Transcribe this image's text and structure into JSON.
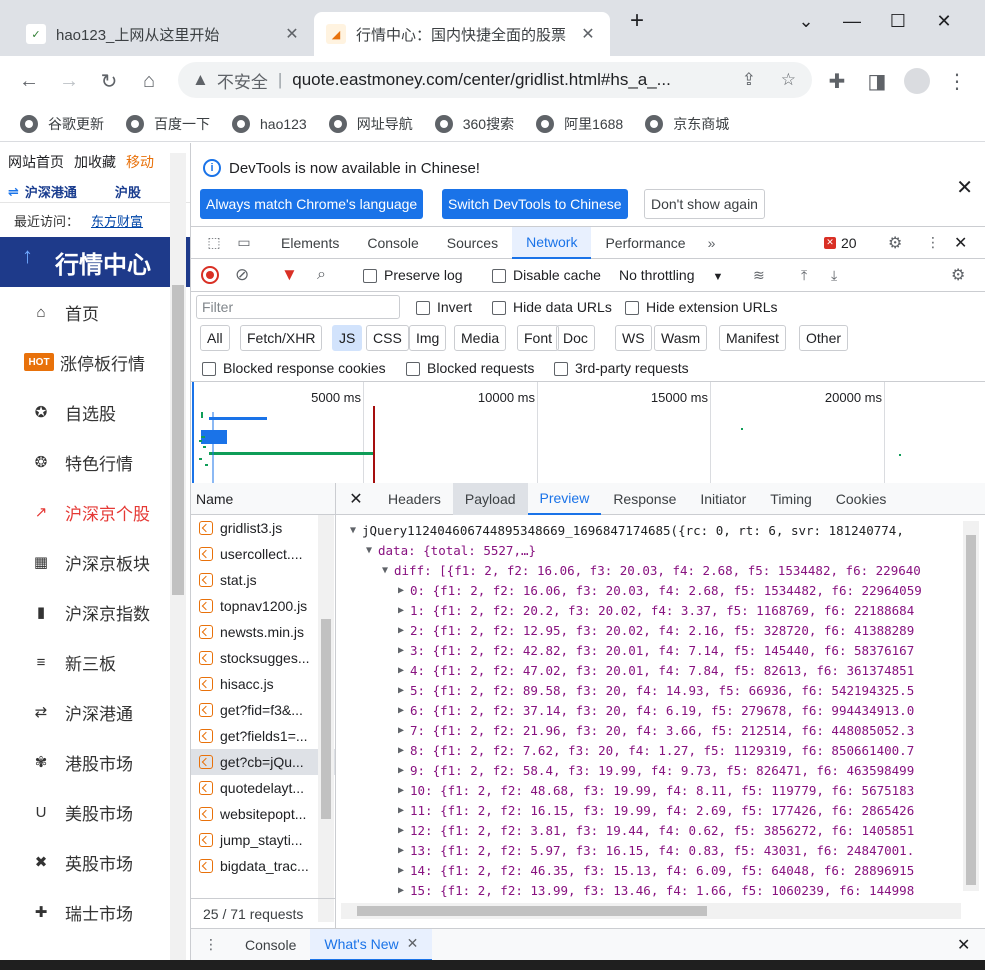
{
  "browser": {
    "tabs": [
      {
        "title": "hao123_上网从这里开始",
        "active": false
      },
      {
        "title": "行情中心：国内快捷全面的股票",
        "active": true
      }
    ],
    "new_tab": "+",
    "address": {
      "security_label": "不安全",
      "url": "quote.eastmoney.com/center/gridlist.html#hs_a_..."
    },
    "bookmarks": [
      "谷歌更新",
      "百度一下",
      "hao123",
      "网址导航",
      "360搜索",
      "阿里1688",
      "京东商城"
    ]
  },
  "page": {
    "top_links": [
      "网站首页",
      "加收藏",
      "移动"
    ],
    "strip": [
      "沪深港通",
      "沪股"
    ],
    "recent_label": "最近访问：",
    "recent_link": "东方财富",
    "banner": "行情中心",
    "nav": [
      {
        "label": "首页",
        "icon": "home-icon",
        "glyph": "⌂"
      },
      {
        "label": "涨停板行情",
        "icon": "hot-icon",
        "glyph": "HOT"
      },
      {
        "label": "自选股",
        "icon": "star-circle-icon",
        "glyph": "✪"
      },
      {
        "label": "特色行情",
        "icon": "award-icon",
        "glyph": "❂"
      },
      {
        "label": "沪深京个股",
        "icon": "trend-icon",
        "glyph": "↗",
        "active": true
      },
      {
        "label": "沪深京板块",
        "icon": "grid-icon",
        "glyph": "▦"
      },
      {
        "label": "沪深京指数",
        "icon": "bar-chart-icon",
        "glyph": "▮"
      },
      {
        "label": "新三板",
        "icon": "list-circle-icon",
        "glyph": "≡"
      },
      {
        "label": "沪深港通",
        "icon": "exchange-icon",
        "glyph": "⇄"
      },
      {
        "label": "港股市场",
        "icon": "flower-icon",
        "glyph": "✾"
      },
      {
        "label": "美股市场",
        "icon": "u-icon",
        "glyph": "U"
      },
      {
        "label": "英股市场",
        "icon": "uk-flag-icon",
        "glyph": "✖"
      },
      {
        "label": "瑞士市场",
        "icon": "swiss-flag-icon",
        "glyph": "✚"
      }
    ]
  },
  "devtools": {
    "info_message": "DevTools is now available in Chinese!",
    "info_buttons": [
      "Always match Chrome's language",
      "Switch DevTools to Chinese",
      "Don't show again"
    ],
    "tabs": [
      "Elements",
      "Console",
      "Sources",
      "Network",
      "Performance"
    ],
    "active_tab": "Network",
    "error_count": "20",
    "net_toolbar": {
      "preserve_log": "Preserve log",
      "disable_cache": "Disable cache",
      "throttling": "No throttling"
    },
    "filter": {
      "placeholder": "Filter",
      "invert": "Invert",
      "hide_data": "Hide data URLs",
      "hide_ext": "Hide extension URLs"
    },
    "types": [
      "All",
      "Fetch/XHR",
      "JS",
      "CSS",
      "Img",
      "Media",
      "Font",
      "Doc",
      "WS",
      "Wasm",
      "Manifest",
      "Other"
    ],
    "active_type": "JS",
    "block": [
      "Blocked response cookies",
      "Blocked requests",
      "3rd-party requests"
    ],
    "timeline_ticks": [
      "5000 ms",
      "10000 ms",
      "15000 ms",
      "20000 ms"
    ],
    "requests_header": "Name",
    "requests": [
      "gridlist3.js",
      "usercollect....",
      "stat.js",
      "topnav1200.js",
      "newsts.min.js",
      "stocksugges...",
      "hisacc.js",
      "get?fid=f3&...",
      "get?fields1=...",
      "get?cb=jQu...",
      "quotedelayt...",
      "websitepopt...",
      "jump_stayti...",
      "bigdata_trac..."
    ],
    "selected_request": 9,
    "request_status": "25 / 71 requests",
    "detail_tabs": [
      "Headers",
      "Payload",
      "Preview",
      "Response",
      "Initiator",
      "Timing",
      "Cookies"
    ],
    "active_detail_tab": "Preview",
    "preview": {
      "root": "jQuery112404606744895348669_1696847174685({rc: 0, rt: 6, svr: 181240774,",
      "data": "data: {total: 5527,…}",
      "diff": "diff: [{f1: 2, f2: 16.06, f3: 20.03, f4: 2.68, f5: 1534482, f6: 229640",
      "rows": [
        "0: {f1: 2, f2: 16.06, f3: 20.03, f4: 2.68, f5: 1534482, f6: 22964059",
        "1: {f1: 2, f2: 20.2, f3: 20.02, f4: 3.37, f5: 1168769, f6: 22188684",
        "2: {f1: 2, f2: 12.95, f3: 20.02, f4: 2.16, f5: 328720, f6: 41388289",
        "3: {f1: 2, f2: 42.82, f3: 20.01, f4: 7.14, f5: 145440, f6: 58376167",
        "4: {f1: 2, f2: 47.02, f3: 20.01, f4: 7.84, f5: 82613, f6: 361374851",
        "5: {f1: 2, f2: 89.58, f3: 20, f4: 14.93, f5: 66936, f6: 542194325.5",
        "6: {f1: 2, f2: 37.14, f3: 20, f4: 6.19, f5: 279678, f6: 994434913.0",
        "7: {f1: 2, f2: 21.96, f3: 20, f4: 3.66, f5: 212514, f6: 448085052.3",
        "8: {f1: 2, f2: 7.62, f3: 20, f4: 1.27, f5: 1129319, f6: 850661400.7",
        "9: {f1: 2, f2: 58.4, f3: 19.99, f4: 9.73, f5: 826471, f6: 463598499",
        "10: {f1: 2, f2: 48.68, f3: 19.99, f4: 8.11, f5: 119779, f6: 5675183",
        "11: {f1: 2, f2: 16.15, f3: 19.99, f4: 2.69, f5: 177426, f6: 2865426",
        "12: {f1: 2, f2: 3.81, f3: 19.44, f4: 0.62, f5: 3856272, f6: 1405851",
        "13: {f1: 2, f2: 5.97, f3: 16.15, f4: 0.83, f5: 43031, f6: 24847001.",
        "14: {f1: 2, f2: 46.35, f3: 15.13, f4: 6.09, f5: 64048, f6: 28896915",
        "15: {f1: 2, f2: 13.99, f3: 13.46, f4: 1.66, f5: 1060239, f6: 144998"
      ]
    },
    "drawer_tabs": [
      "Console",
      "What's New"
    ],
    "active_drawer_tab": "What's New"
  },
  "colors": {
    "accent": "#1a73e8",
    "nav_active": "#e53935",
    "banner": "#1e3a8a"
  }
}
